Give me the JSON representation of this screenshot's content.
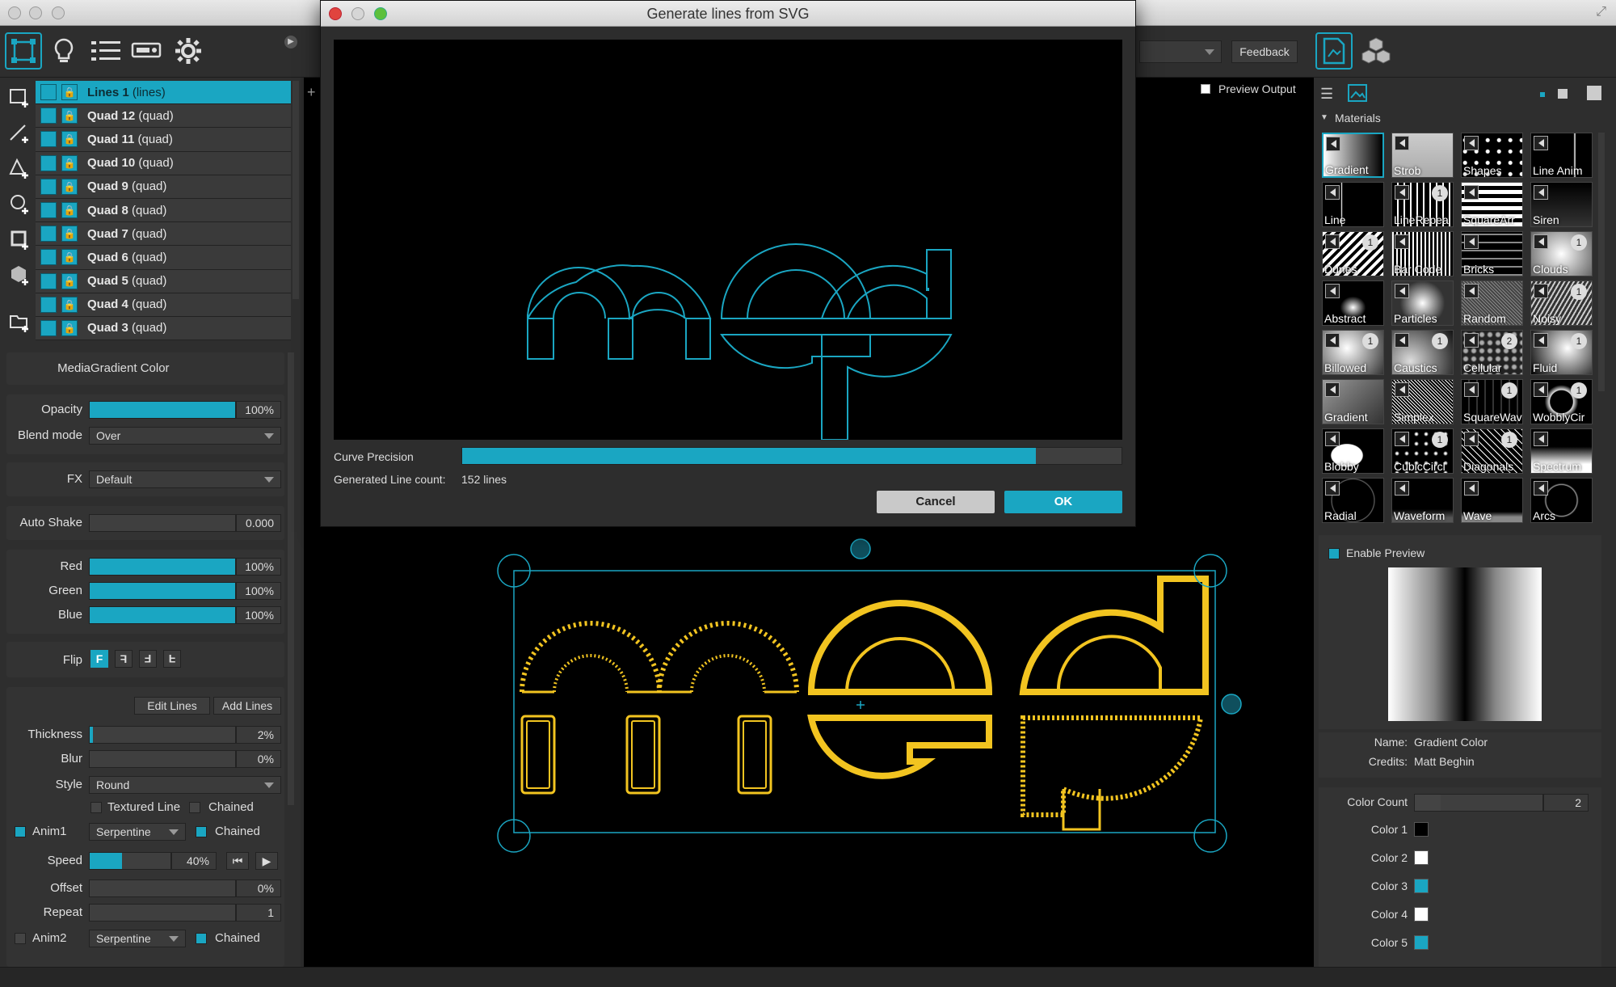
{
  "dialog": {
    "title": "Generate lines from SVG",
    "curve_precision_label": "Curve Precision",
    "curve_precision_fraction": 0.87,
    "line_count_label": "Generated Line count:",
    "line_count_value": "152 lines",
    "cancel_label": "Cancel",
    "ok_label": "OK"
  },
  "toolbar": {
    "feedback_label": "Feedback",
    "preview_output_label": "Preview Output"
  },
  "layers": [
    {
      "name": "Lines 1",
      "kind": "(lines)",
      "selected": true
    },
    {
      "name": "Quad 12",
      "kind": "(quad)"
    },
    {
      "name": "Quad 11",
      "kind": "(quad)"
    },
    {
      "name": "Quad 10",
      "kind": "(quad)"
    },
    {
      "name": "Quad 9",
      "kind": "(quad)"
    },
    {
      "name": "Quad 8",
      "kind": "(quad)"
    },
    {
      "name": "Quad 7",
      "kind": "(quad)"
    },
    {
      "name": "Quad 6",
      "kind": "(quad)"
    },
    {
      "name": "Quad 5",
      "kind": "(quad)"
    },
    {
      "name": "Quad 4",
      "kind": "(quad)"
    },
    {
      "name": "Quad 3",
      "kind": "(quad)"
    }
  ],
  "props": {
    "media_label": "Media",
    "media_value": "Gradient Color",
    "opacity_label": "Opacity",
    "opacity_value": "100%",
    "opacity_fraction": 1.0,
    "blend_label": "Blend mode",
    "blend_value": "Over",
    "fx_label": "FX",
    "fx_value": "Default",
    "autoshake_label": "Auto Shake",
    "autoshake_value": "0.000",
    "autoshake_fraction": 0.0,
    "red_label": "Red",
    "red_value": "100%",
    "red_fraction": 1.0,
    "green_label": "Green",
    "green_value": "100%",
    "green_fraction": 1.0,
    "blue_label": "Blue",
    "blue_value": "100%",
    "blue_fraction": 1.0,
    "flip_label": "Flip",
    "edit_lines_label": "Edit Lines",
    "add_lines_label": "Add Lines",
    "thickness_label": "Thickness",
    "thickness_value": "2%",
    "thickness_fraction": 0.02,
    "blur_label": "Blur",
    "blur_value": "0%",
    "blur_fraction": 0.0,
    "style_label": "Style",
    "style_value": "Round",
    "textured_line_label": "Textured Line",
    "chained_label": "Chained",
    "anim1_label": "Anim1",
    "anim1_value": "Serpentine",
    "anim1_chained": "Chained",
    "speed_label": "Speed",
    "speed_value": "40%",
    "speed_fraction": 0.4,
    "offset_label": "Offset",
    "offset_value": "0%",
    "offset_fraction": 0.0,
    "repeat_label": "Repeat",
    "repeat_value": "1",
    "repeat_fraction": 0.0,
    "anim2_label": "Anim2",
    "anim2_value": "Serpentine",
    "anim2_chained": "Chained"
  },
  "materials": {
    "header": "Materials",
    "items": [
      {
        "name": "Gradient",
        "badge": "",
        "selected": true
      },
      {
        "name": "Strob",
        "badge": ""
      },
      {
        "name": "Shapes",
        "badge": ""
      },
      {
        "name": "Line Anim",
        "badge": ""
      },
      {
        "name": "Line",
        "badge": ""
      },
      {
        "name": "LineRepea",
        "badge": "1"
      },
      {
        "name": "SquareArr",
        "badge": ""
      },
      {
        "name": "Siren",
        "badge": ""
      },
      {
        "name": "Dunes",
        "badge": "1"
      },
      {
        "name": "Bar Code",
        "badge": ""
      },
      {
        "name": "Bricks",
        "badge": ""
      },
      {
        "name": "Clouds",
        "badge": "1"
      },
      {
        "name": "Abstract",
        "badge": ""
      },
      {
        "name": "Particles",
        "badge": ""
      },
      {
        "name": "Random",
        "badge": ""
      },
      {
        "name": "Noisy",
        "badge": "1"
      },
      {
        "name": "Billowed",
        "badge": "1"
      },
      {
        "name": "Caustics",
        "badge": "1"
      },
      {
        "name": "Cellular",
        "badge": "2"
      },
      {
        "name": "Fluid",
        "badge": "1"
      },
      {
        "name": "Gradient",
        "badge": ""
      },
      {
        "name": "Simplex",
        "badge": ""
      },
      {
        "name": "SquareWav",
        "badge": "1"
      },
      {
        "name": "WobblyCir",
        "badge": "1"
      },
      {
        "name": "Blobby",
        "badge": ""
      },
      {
        "name": "CubicCircl",
        "badge": "1"
      },
      {
        "name": "Diagonals",
        "badge": "1"
      },
      {
        "name": "Spectrum",
        "badge": ""
      },
      {
        "name": "Radial",
        "badge": ""
      },
      {
        "name": "Waveform",
        "badge": ""
      },
      {
        "name": "Wave",
        "badge": ""
      },
      {
        "name": "Arcs",
        "badge": ""
      }
    ],
    "enable_preview_label": "Enable Preview",
    "name_label": "Name:",
    "name_value": "Gradient Color",
    "credits_label": "Credits:",
    "credits_value": "Matt Beghin",
    "color_count_label": "Color Count",
    "color_count_value": "2",
    "color_count_fraction": 0.2,
    "colors": [
      {
        "label": "Color 1",
        "hex": "#000000"
      },
      {
        "label": "Color 2",
        "hex": "#ffffff"
      },
      {
        "label": "Color 3",
        "hex": "#1aa6c2"
      },
      {
        "label": "Color 4",
        "hex": "#ffffff"
      },
      {
        "label": "Color 5",
        "hex": "#1aa6c2"
      }
    ]
  },
  "colors": {
    "accent": "#1aa6c2",
    "lines_yellow": "#f2c420"
  }
}
